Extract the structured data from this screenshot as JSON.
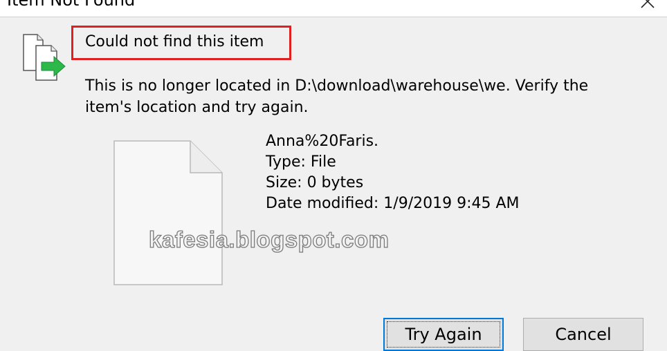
{
  "window": {
    "title": "Item Not Found",
    "close_glyph": "✕"
  },
  "dialog": {
    "heading": "Could not find this item",
    "message": "This is no longer located in D:\\download\\warehouse\\we. Verify the item's location and try again.",
    "file": {
      "name": "Anna%20Faris.",
      "type": "Type: File",
      "size": "Size: 0 bytes",
      "modified": "Date modified: 1/9/2019 9:45 AM"
    }
  },
  "watermark": "kafesia.blogspot.com",
  "buttons": {
    "try_again": "Try Again",
    "cancel": "Cancel"
  },
  "colors": {
    "highlight_box": "#e02020",
    "primary_border": "#0078d7",
    "arrow_green": "#2db84a"
  }
}
